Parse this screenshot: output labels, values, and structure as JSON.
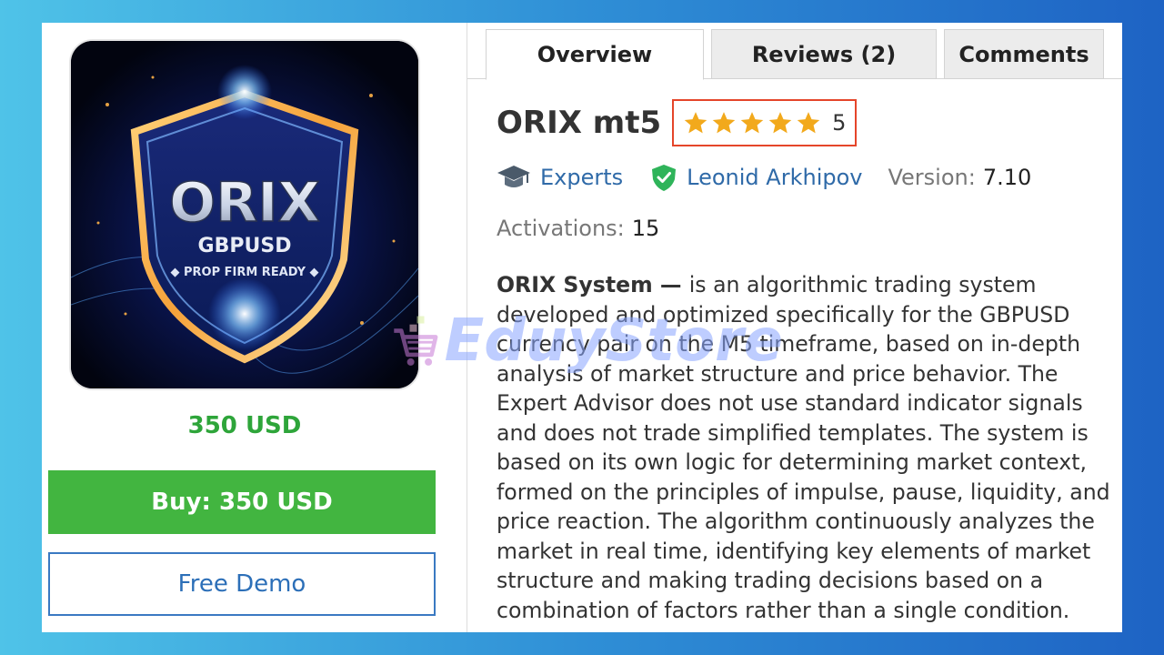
{
  "product": {
    "image_text_main": "ORIX",
    "image_text_pair": "GBPUSD",
    "image_text_tag": "◆ PROP FIRM READY ◆",
    "price": "350 USD",
    "buy_label": "Buy: 350 USD",
    "demo_label": "Free Demo"
  },
  "tabs": [
    {
      "label": "Overview",
      "active": true
    },
    {
      "label": "Reviews (2)",
      "active": false
    },
    {
      "label": "Comments",
      "active": false
    }
  ],
  "header": {
    "title": "ORIX mt5",
    "rating_stars": 5,
    "rating_value": "5"
  },
  "meta": {
    "category": "Experts",
    "author": "Leonid Arkhipov",
    "version_label": "Version:",
    "version_value": "7.10",
    "activations_label": "Activations:",
    "activations_value": "15"
  },
  "description": {
    "lead": "ORIX System — ",
    "body": "is an algorithmic trading system developed and optimized specifically for the GBPUSD currency pair on the M5 timeframe, based on in-depth analysis of market structure and price behavior. The Expert Advisor does not use standard indicator signals and does not trade simplified templates. The system is based on its own logic for determining market context, formed on the principles of impulse, pause, liquidity, and price reaction. The algorithm continuously analyzes the market in real time, identifying key elements of market structure and making trading decisions based on a combination of factors rather than a single condition."
  },
  "watermark": {
    "text": "EduyStore"
  },
  "colors": {
    "price_green": "#2ea53a",
    "buy_green": "#42b540",
    "link_blue": "#2f6aa8",
    "star_gold": "#f2a91c",
    "rating_border": "#e5452a"
  }
}
